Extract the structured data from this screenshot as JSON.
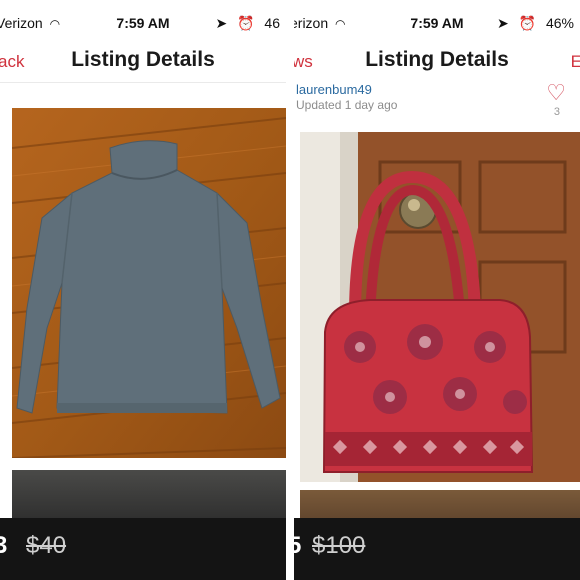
{
  "left_screen": {
    "status": {
      "carrier": "Verizon",
      "wifi_icon": "wifi-icon",
      "time": "7:59 AM",
      "battery": "46"
    },
    "nav": {
      "back_label": "ack",
      "title": "Listing Details"
    },
    "item_photo": "gray-turtleneck-sweater-photo",
    "price": {
      "current": "3",
      "original": "$40"
    }
  },
  "right_screen": {
    "status": {
      "carrier": "erizon",
      "wifi_icon": "wifi-icon",
      "time": "7:59 AM",
      "battery": "46%"
    },
    "nav": {
      "back_label": "ws",
      "title": "Listing Details",
      "edit_label": "E"
    },
    "seller": {
      "username": "laurenbum49",
      "updated": "Updated 1 day ago",
      "likes": "3"
    },
    "item_photo": "red-paisley-handbag-photo",
    "price": {
      "current": "5",
      "original": "$100"
    }
  },
  "colors": {
    "accent": "#d0323d",
    "price_bar": "#141414",
    "link": "#2b6aa0"
  }
}
